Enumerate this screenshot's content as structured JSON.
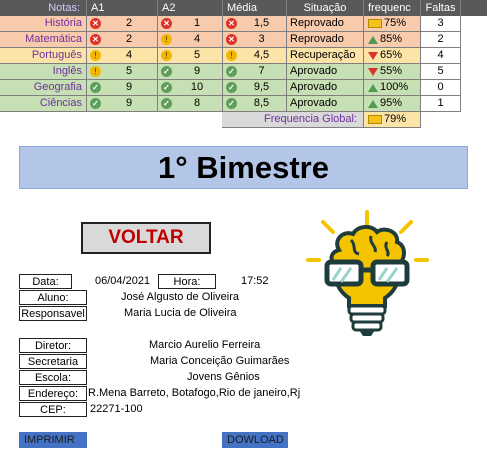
{
  "header": {
    "notas": "Notas:",
    "a1": "A1",
    "a2": "A2",
    "media": "Média",
    "situacao": "Situação",
    "frequencia": "frequenc",
    "faltas": "Faltas"
  },
  "grades": [
    {
      "subject": "História",
      "a1": "2",
      "a1_icon": "x-circle-icon",
      "a2": "1",
      "a2_icon": "x-circle-icon",
      "media": "1,5",
      "media_icon": "x-circle-icon",
      "situacao": "Reprovado",
      "freq": "75%",
      "freq_trend": "flat",
      "faltas": "3",
      "row_color": "red"
    },
    {
      "subject": "Matemática",
      "a1": "2",
      "a1_icon": "x-circle-icon",
      "a2": "4",
      "a2_icon": "exclamation-circle-icon",
      "media": "3",
      "media_icon": "x-circle-icon",
      "situacao": "Reprovado",
      "freq": "85%",
      "freq_trend": "up",
      "faltas": "2",
      "row_color": "red"
    },
    {
      "subject": "Português",
      "a1": "4",
      "a1_icon": "exclamation-circle-icon",
      "a2": "5",
      "a2_icon": "exclamation-circle-icon",
      "media": "4,5",
      "media_icon": "exclamation-circle-icon",
      "situacao": "Recuperação",
      "freq": "65%",
      "freq_trend": "down",
      "faltas": "4",
      "row_color": "yellow"
    },
    {
      "subject": "Inglês",
      "a1": "5",
      "a1_icon": "exclamation-circle-icon",
      "a2": "9",
      "a2_icon": "check-circle-icon",
      "media": "7",
      "media_icon": "check-circle-icon",
      "situacao": "Aprovado",
      "freq": "55%",
      "freq_trend": "down",
      "faltas": "5",
      "row_color": "green"
    },
    {
      "subject": "Geografia",
      "a1": "9",
      "a1_icon": "check-circle-icon",
      "a2": "10",
      "a2_icon": "check-circle-icon",
      "media": "9,5",
      "media_icon": "check-circle-icon",
      "situacao": "Aprovado",
      "freq": "100%",
      "freq_trend": "up",
      "faltas": "0",
      "row_color": "green"
    },
    {
      "subject": "Ciências",
      "a1": "9",
      "a1_icon": "check-circle-icon",
      "a2": "8",
      "a2_icon": "check-circle-icon",
      "media": "8,5",
      "media_icon": "check-circle-icon",
      "situacao": "Aprovado",
      "freq": "95%",
      "freq_trend": "up",
      "faltas": "1",
      "row_color": "green"
    }
  ],
  "global_freq": {
    "label": "Frequencia Global:",
    "value": "79%",
    "trend": "flat"
  },
  "banner": {
    "title": "1° Bimestre"
  },
  "voltar_label": "VOLTAR",
  "info": {
    "data_label": "Data:",
    "data_value": "06/04/2021",
    "hora_label": "Hora:",
    "hora_value": "17:52",
    "aluno_label": "Aluno:",
    "aluno_value": "José Algusto de Oliveira",
    "responsavel_label": "Responsavel",
    "responsavel_value": "Maria Lucia de Oliveira",
    "diretor_label": "Diretor:",
    "diretor_value": "Marcio Aurelio Ferreira",
    "secretaria_label": "Secretaria",
    "secretaria_value": "Maria Conceição Guimarães",
    "escola_label": "Escola:",
    "escola_value": "Jovens Gênios",
    "endereco_label": "Endereço:",
    "endereco_value": "R.Mena Barreto, Botafogo,Rio de janeiro,Rj",
    "cep_label": "CEP:",
    "cep_value": "22271-100"
  },
  "buttons": {
    "imprimir": "IMPRIMIR",
    "download": "DOWLOAD"
  },
  "colors": {
    "header": "#595959",
    "red_row": "#f8cbad",
    "yellow_row": "#fce4a8",
    "green_row": "#c6e0b4",
    "banner": "#b4c6e7",
    "accent_blue": "#4472c4",
    "voltar_text": "#c00000"
  },
  "logo_icon": "brain-lightbulb-with-glasses-icon"
}
